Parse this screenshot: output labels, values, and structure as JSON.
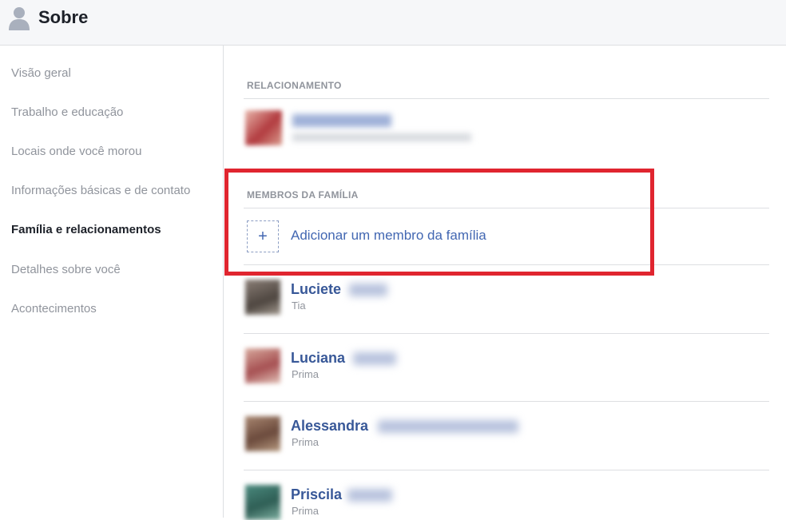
{
  "header": {
    "icon": "person-icon",
    "title": "Sobre"
  },
  "sidebar": {
    "items": [
      {
        "label": "Visão geral",
        "active": false
      },
      {
        "label": "Trabalho e educação",
        "active": false
      },
      {
        "label": "Locais onde você morou",
        "active": false
      },
      {
        "label": "Informações básicas e de contato",
        "active": false
      },
      {
        "label": "Família e relacionamentos",
        "active": true
      },
      {
        "label": "Detalhes sobre você",
        "active": false
      },
      {
        "label": "Acontecimentos",
        "active": false
      }
    ]
  },
  "relationship": {
    "section_title": "RELACIONAMENTO"
  },
  "family": {
    "section_title": "MEMBROS DA FAMÍLIA",
    "add_icon": "+",
    "add_label": "Adicionar um membro da família",
    "members": [
      {
        "name": "Luciete",
        "relation": "Tia"
      },
      {
        "name": "Luciana",
        "relation": "Prima"
      },
      {
        "name": "Alessandra",
        "relation": "Prima"
      },
      {
        "name": "Priscila",
        "relation": "Prima"
      }
    ]
  },
  "colors": {
    "link": "#4267b2",
    "member_name": "#385898",
    "muted": "#90949c",
    "highlight_box": "#e0252f"
  }
}
